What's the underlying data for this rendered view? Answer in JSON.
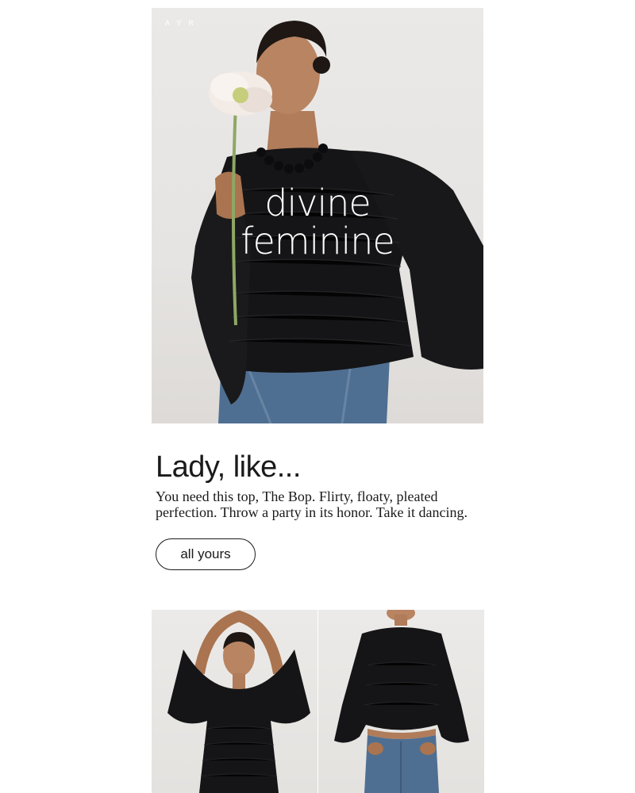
{
  "brand": {
    "logo_text": "AYR"
  },
  "hero": {
    "headline_line1": "divine",
    "headline_line2": "feminine",
    "image": "model-smelling-poppy-black-pleated-top"
  },
  "copy": {
    "heading": "Lady, like...",
    "body": "You need this top, The Bop. Flirty, floaty, pleated perfection. Throw a party in its honor. Take it dancing.",
    "cta_label": "all yours"
  },
  "products": [
    {
      "image": "model-arms-raised-black-pleated-top"
    },
    {
      "image": "black-pleated-top-with-jeans"
    }
  ],
  "colors": {
    "background": "#ffffff",
    "text": "#1a1a1a",
    "photo_backdrop": "#e8e6e4",
    "garment": "#151517",
    "denim": "#4f6f92"
  }
}
